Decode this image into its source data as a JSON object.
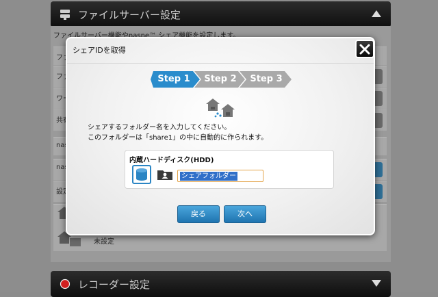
{
  "background": {
    "top_panel": {
      "title": "ファイルサーバー設定",
      "description": "ファイルサーバー機能やnasne™ シェア機能を設定します。"
    },
    "rows": [
      "ファ",
      "ファ",
      "ワー",
      "共有",
      "nas",
      "nas",
      "設定"
    ],
    "status_text": "未設定",
    "bottom_panel": {
      "title": "レコーダー設定"
    }
  },
  "dialog": {
    "title": "シェアIDを取得",
    "steps": [
      {
        "label": "Step 1",
        "active": true
      },
      {
        "label": "Step 2",
        "active": false
      },
      {
        "label": "Step 3",
        "active": false
      }
    ],
    "instruction_line1": "シェアするフォルダー名を入力してください。",
    "instruction_line2": "このフォルダーは「share1」の中に自動的に作られます。",
    "drive_title": "内蔵ハードディスク(HDD)",
    "folder_input_value": "シェアフォルダー",
    "back_label": "戻る",
    "next_label": "次へ"
  },
  "colors": {
    "step_active": "#2a8ccc",
    "step_inactive": "#a9a9a9",
    "button": "#2f8bc8",
    "input_border": "#e3a44a",
    "hdd_accent": "#2b85c4"
  }
}
